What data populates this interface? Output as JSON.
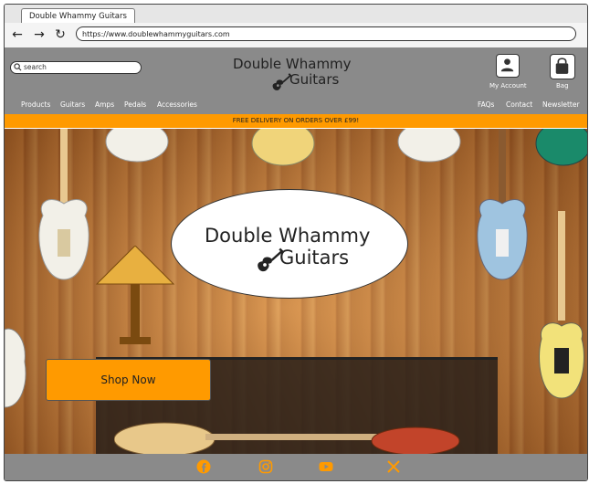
{
  "browser": {
    "tab_title": "Double Whammy Guitars",
    "url": "https://www.doublewhammyguitars.com",
    "back_icon": "back-arrow-icon",
    "forward_icon": "forward-arrow-icon",
    "reload_icon": "reload-icon"
  },
  "header": {
    "search_placeholder": "search",
    "logo_line1": "Double Whammy",
    "logo_line2": "Guitars",
    "account_label": "My Account",
    "bag_label": "Bag"
  },
  "nav": {
    "left": [
      "Products",
      "Guitars",
      "Amps",
      "Pedals",
      "Accessories"
    ],
    "right": [
      "FAQs",
      "Contact",
      "Newsletter"
    ]
  },
  "banner": {
    "text": "FREE DELIVERY ON ORDERS OVER £99!"
  },
  "hero": {
    "logo_line1": "Double Whammy",
    "logo_line2": "Guitars",
    "cta_label": "Shop Now"
  },
  "footer": {
    "social": [
      "facebook-icon",
      "instagram-icon",
      "youtube-icon",
      "x-icon"
    ]
  },
  "colors": {
    "accent": "#ff9a00",
    "header_bg": "#8a8a8a",
    "white": "#ffffff"
  }
}
